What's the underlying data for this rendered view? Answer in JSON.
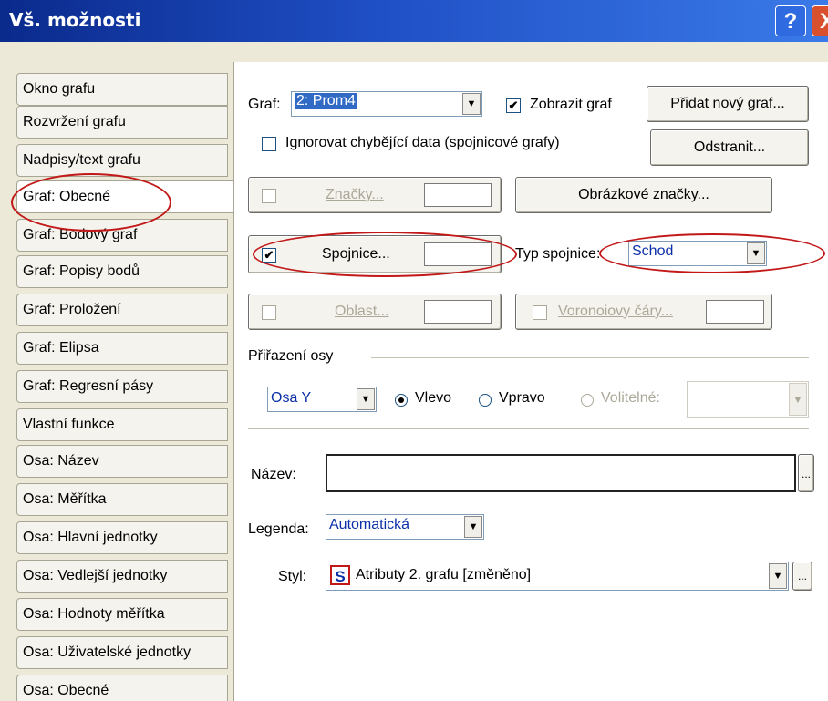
{
  "window": {
    "title": "Vš. možnosti",
    "help_label": "?",
    "close_label": "X"
  },
  "tabs": [
    "Okno grafu",
    "Rozvržení grafu",
    "Nadpisy/text grafu",
    "Graf: Obecné",
    "Graf: Bodový graf",
    "Graf: Popisy bodů",
    "Graf: Proložení",
    "Graf: Elipsa",
    "Graf: Regresní pásy",
    "Vlastní funkce",
    "Osa: Název",
    "Osa: Měřítka",
    "Osa: Hlavní jednotky",
    "Osa: Vedlejší jednotky",
    "Osa: Hodnoty měřítka",
    "Osa: Uživatelské jednotky",
    "Osa: Obecné"
  ],
  "active_tab": "Graf: Obecné",
  "graph": {
    "label": "Graf:",
    "selected": "2: Prom4",
    "show_label": "Zobrazit graf",
    "show_checked": true,
    "add_button": "Přidat nový graf...",
    "remove_button": "Odstranit...",
    "ignore_missing_label": "Ignorovat chybějící data (spojnicové grafy)",
    "ignore_missing_checked": false
  },
  "markers": {
    "button": "Značky...",
    "checked": false,
    "image_button": "Obrázkové značky..."
  },
  "lines": {
    "button": "Spojnice...",
    "checked": true,
    "type_label": "Typ spojnice:",
    "type_value": "Schod"
  },
  "area": {
    "button": "Oblast...",
    "checked": false,
    "voronoi_button": "Voronoiovy čáry...",
    "voronoi_checked": false
  },
  "axis_assignment": {
    "group_label": "Přiřazení osy",
    "axis_value": "Osa Y",
    "left_label": "Vlevo",
    "right_label": "Vpravo",
    "custom_label": "Volitelné:",
    "selected": "Vlevo"
  },
  "name": {
    "label": "Název:",
    "value": "",
    "ellipsis": "..."
  },
  "legend": {
    "label": "Legenda:",
    "value": "Automatická"
  },
  "style": {
    "label": "Styl:",
    "icon_letter": "S",
    "value": "Atributy 2. grafu [změněno]",
    "ellipsis": "..."
  },
  "colors": {
    "highlight_ellipse": "#c21818",
    "title_bar": "#1f4fc4",
    "link_text": "#0b2fa8"
  }
}
